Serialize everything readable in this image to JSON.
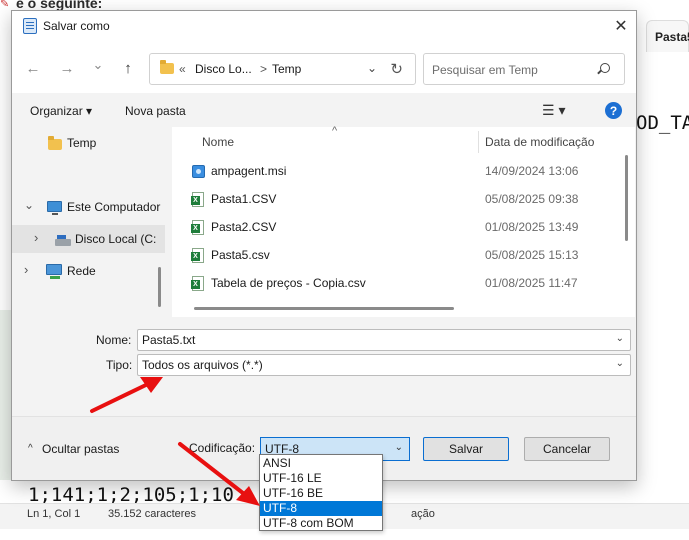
{
  "background": {
    "heading": "é o seguinte:",
    "tab_label": "Pasta5",
    "code_right": "OD_TA",
    "code_bottom": "1;141;1;2;105;1;10",
    "status_position": "Ln 1, Col 1",
    "status_chars": "35.152 caracteres",
    "status_fragment": "ação"
  },
  "dialog": {
    "title": "Salvar como",
    "close_glyph": "✕",
    "nav": {
      "back_glyph": "←",
      "forward_glyph": "→",
      "recent_glyph": "⌄",
      "up_glyph": "↑"
    },
    "address": {
      "overflow": "«",
      "segments": [
        "Disco Lo...",
        "Temp"
      ],
      "separator": ">",
      "dropdown_glyph": "⌄",
      "refresh_glyph": "↻"
    },
    "search_placeholder": "Pesquisar em Temp",
    "toolbar": {
      "organize": "Organizar ▾",
      "new_folder": "Nova pasta",
      "view_glyph": "☰ ▾",
      "help_glyph": "?"
    },
    "sidebar": {
      "items": [
        {
          "label": "Temp",
          "chevron": ""
        },
        {
          "label": "Este Computador",
          "chevron": "⌄"
        },
        {
          "label": "Disco Local (C:",
          "chevron": "›"
        },
        {
          "label": "Rede",
          "chevron": "›"
        }
      ]
    },
    "filelist": {
      "col_name": "Nome",
      "col_date": "Data de modificação",
      "sort_glyph": "^",
      "rows": [
        {
          "name": "ampagent.msi",
          "date": "14/09/2024 13:06",
          "icon": "msi-icon"
        },
        {
          "name": "Pasta1.CSV",
          "date": "05/08/2025 09:38",
          "icon": "excel-csv-icon"
        },
        {
          "name": "Pasta2.CSV",
          "date": "01/08/2025 13:49",
          "icon": "excel-csv-icon"
        },
        {
          "name": "Pasta5.csv",
          "date": "05/08/2025 15:13",
          "icon": "excel-csv-icon"
        },
        {
          "name": "Tabela de preços - Copia.csv",
          "date": "01/08/2025 11:47",
          "icon": "excel-csv-icon"
        }
      ]
    },
    "form": {
      "name_label": "Nome:",
      "name_value": "Pasta5.txt",
      "type_label": "Tipo:",
      "type_value": "Todos os arquivos  (*.*)",
      "dropdown_glyph": "⌄"
    },
    "bottom": {
      "hide_folders": "Ocultar pastas",
      "hide_glyph": "^",
      "encoding_label": "Codificação:",
      "encoding_value": "UTF-8",
      "encoding_dropdown_glyph": "⌄",
      "save": "Salvar",
      "cancel": "Cancelar"
    },
    "encoding_options": [
      "ANSI",
      "UTF-16 LE",
      "UTF-16 BE",
      "UTF-8",
      "UTF-8 com BOM"
    ],
    "encoding_selected": "UTF-8"
  },
  "colors": {
    "accent": "#0078d7",
    "arrow": "#e81010",
    "folder": "#f2c14e",
    "excel": "#1e7d3a"
  }
}
